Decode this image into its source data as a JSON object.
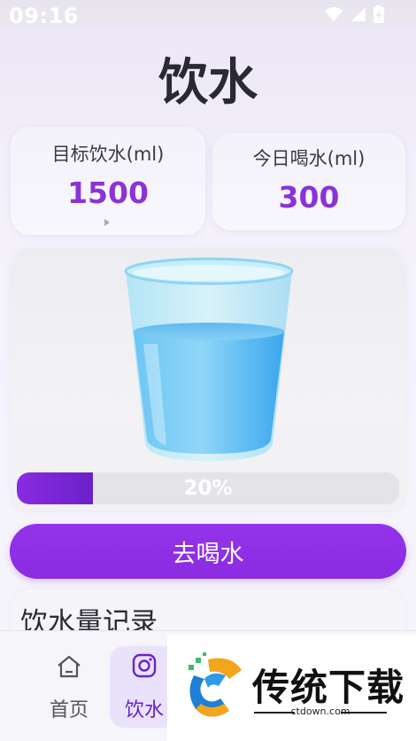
{
  "status_bar": {
    "time": "09:16"
  },
  "page": {
    "title": "饮水"
  },
  "stats": {
    "target_label": "目标饮水(ml)",
    "target_value": "1500",
    "today_label": "今日喝水(ml)",
    "today_value": "300"
  },
  "progress": {
    "fraction": 0.2,
    "label": "20%"
  },
  "actions": {
    "drink_button": "去喝水"
  },
  "records": {
    "title": "饮水量记录"
  },
  "bottom_nav": {
    "items": [
      {
        "label": "首页",
        "icon": "home-icon",
        "active": false
      },
      {
        "label": "饮水",
        "icon": "instagram-camera-icon",
        "active": true
      }
    ]
  },
  "watermark": {
    "text": "传统下载",
    "url": "ctdown.com"
  },
  "colors": {
    "accent": "#8a2be2",
    "value_text": "#8a33d6",
    "water": "#4fb8f5"
  },
  "icons": [
    "wifi-icon",
    "signal-icon",
    "battery-icon",
    "home-icon",
    "instagram-camera-icon",
    "water-glass-icon"
  ]
}
